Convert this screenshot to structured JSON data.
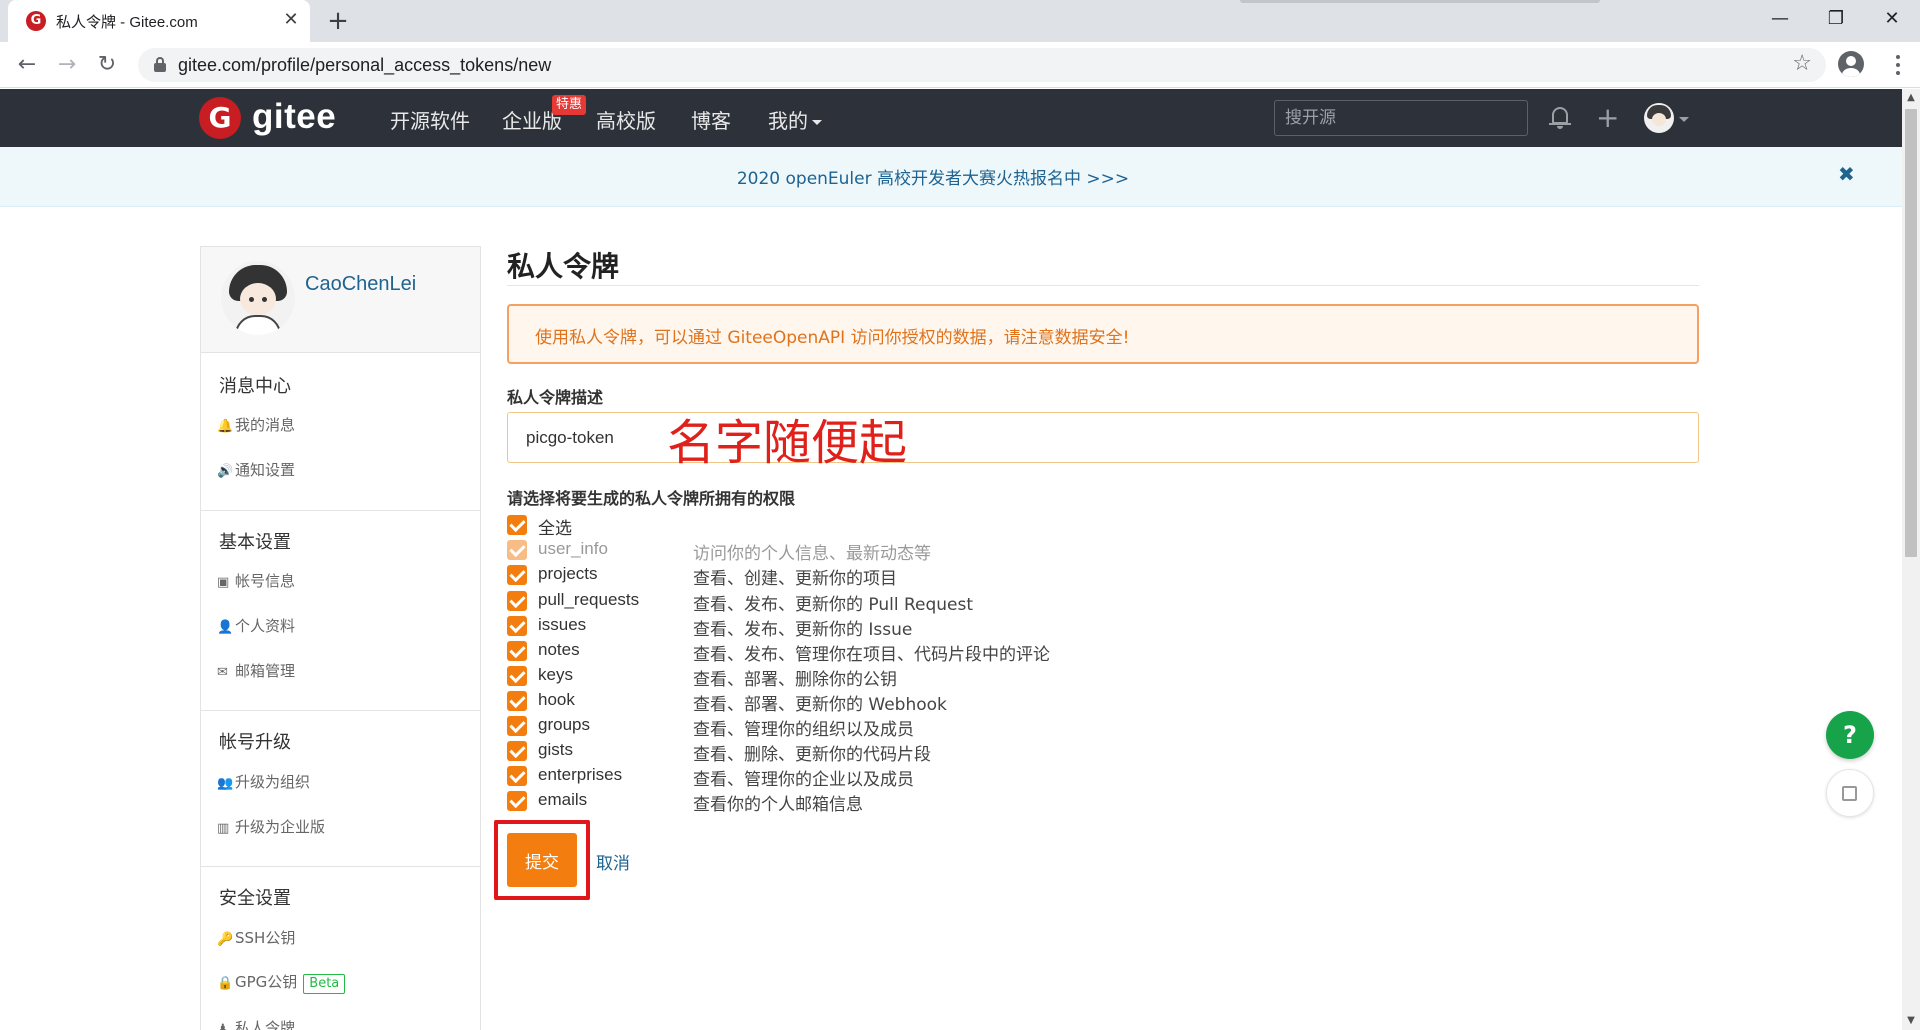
{
  "browser": {
    "tab_title": "私人令牌 - Gitee.com",
    "favicon_letter": "G",
    "url": "gitee.com/profile/personal_access_tokens/new",
    "new_tab_symbol": "+",
    "close_symbol": "✕",
    "window_controls": {
      "minimize": "—",
      "maximize": "❐",
      "close": "✕"
    },
    "nav": {
      "back": "←",
      "forward": "→",
      "reload": "↻"
    },
    "star": "☆"
  },
  "header": {
    "logo_letter": "G",
    "logo_text": "gitee",
    "nav": [
      "开源软件",
      "企业版",
      "高校版",
      "博客",
      "我的"
    ],
    "hot_badge": "特惠",
    "search_placeholder": "搜开源",
    "plus": "+"
  },
  "announcement": {
    "text": "2020 openEuler 高校开发者大赛火热报名中 >>>",
    "close": "✖"
  },
  "sidebar": {
    "username": "CaoChenLei",
    "sections": [
      {
        "title": "消息中心",
        "items": [
          {
            "icon": "🔔",
            "label": "我的消息"
          },
          {
            "icon": "🔊",
            "label": "通知设置"
          }
        ]
      },
      {
        "title": "基本设置",
        "items": [
          {
            "icon": "▣",
            "label": "帐号信息"
          },
          {
            "icon": "👤",
            "label": "个人资料"
          },
          {
            "icon": "✉",
            "label": "邮箱管理"
          }
        ]
      },
      {
        "title": "帐号升级",
        "items": [
          {
            "icon": "👥",
            "label": "升级为组织"
          },
          {
            "icon": "▥",
            "label": "升级为企业版"
          }
        ]
      },
      {
        "title": "安全设置",
        "items": [
          {
            "icon": "🔑",
            "label": "SSH公钥"
          },
          {
            "icon": "🔒",
            "label": "GPG公钥",
            "badge": "Beta"
          },
          {
            "icon": "♟",
            "label": "私人令牌"
          }
        ]
      }
    ]
  },
  "main": {
    "title": "私人令牌",
    "warning": "使用私人令牌，可以通过 GiteeOpenAPI 访问你授权的数据，请注意数据安全!",
    "desc_label": "私人令牌描述",
    "desc_value": "picgo-token",
    "annotation": "名字随便起",
    "perm_label": "请选择将要生成的私人令牌所拥有的权限",
    "permissions": [
      {
        "name": "全选",
        "desc": "",
        "checked": true,
        "disabled": false
      },
      {
        "name": "user_info",
        "desc": "访问你的个人信息、最新动态等",
        "checked": true,
        "disabled": true
      },
      {
        "name": "projects",
        "desc": "查看、创建、更新你的项目",
        "checked": true,
        "disabled": false
      },
      {
        "name": "pull_requests",
        "desc": "查看、发布、更新你的 Pull Request",
        "checked": true,
        "disabled": false
      },
      {
        "name": "issues",
        "desc": "查看、发布、更新你的 Issue",
        "checked": true,
        "disabled": false
      },
      {
        "name": "notes",
        "desc": "查看、发布、管理你在项目、代码片段中的评论",
        "checked": true,
        "disabled": false
      },
      {
        "name": "keys",
        "desc": "查看、部署、删除你的公钥",
        "checked": true,
        "disabled": false
      },
      {
        "name": "hook",
        "desc": "查看、部署、更新你的 Webhook",
        "checked": true,
        "disabled": false
      },
      {
        "name": "groups",
        "desc": "查看、管理你的组织以及成员",
        "checked": true,
        "disabled": false
      },
      {
        "name": "gists",
        "desc": "查看、删除、更新你的代码片段",
        "checked": true,
        "disabled": false
      },
      {
        "name": "enterprises",
        "desc": "查看、管理你的企业以及成员",
        "checked": true,
        "disabled": false
      },
      {
        "name": "emails",
        "desc": "查看你的个人邮箱信息",
        "checked": true,
        "disabled": false
      }
    ],
    "submit": "提交",
    "cancel": "取消"
  },
  "floating": {
    "help": "?"
  },
  "colors": {
    "header_bg": "#2d323a",
    "brand_red": "#c71d23",
    "accent_orange": "#f37e0f",
    "link_blue": "#1f6391",
    "highlight_red": "#e0161b"
  }
}
